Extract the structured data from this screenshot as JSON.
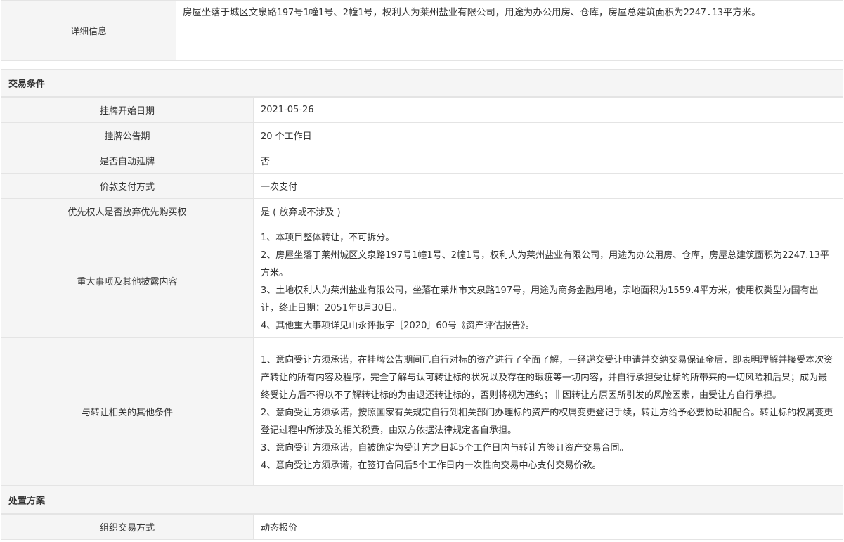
{
  "detail": {
    "label": "详细信息",
    "text": "房屋坐落于城区文泉路197号1幢1号、2幢1号，权利人为莱州盐业有限公司，用途为办公用房、仓库，房屋总建筑面积为2247.13平方米。"
  },
  "trade_conditions": {
    "title": "交易条件",
    "rows": [
      {
        "label": "挂牌开始日期",
        "value": "2021-05-26"
      },
      {
        "label": "挂牌公告期",
        "value": "20 个工作日"
      },
      {
        "label": "是否自动延牌",
        "value": "否"
      },
      {
        "label": "价款支付方式",
        "value": "一次支付"
      },
      {
        "label": "优先权人是否放弃优先购买权",
        "value": "是 ( 放弃或不涉及 )"
      }
    ],
    "major_matters": {
      "label": "重大事项及其他披露内容",
      "items": [
        "1、本项目整体转让，不可拆分。",
        "2、房屋坐落于莱州城区文泉路197号1幢1号、2幢1号，权利人为莱州盐业有限公司，用途为办公用房、仓库，房屋总建筑面积为2247.13平方米。",
        "3、土地权利人为莱州盐业有限公司，坐落在莱州市文泉路197号，用途为商务金融用地，宗地面积为1559.4平方米，使用权类型为国有出让，终止日期：2051年8月30日。",
        "4、其他重大事项详见山永评报字［2020］60号《资产评估报告》。"
      ]
    },
    "other_conditions": {
      "label": "与转让相关的其他条件",
      "items": [
        "1、意向受让方须承诺，在挂牌公告期间已自行对标的资产进行了全面了解，一经递交受让申请并交纳交易保证金后，即表明理解并接受本次资产转让的所有内容及程序，完全了解与认可转让标的状况以及存在的瑕疵等一切内容，并自行承担受让标的所带来的一切风险和后果；成为最终受让方后不得以不了解转让标的为由退还转让标的，否则将视为违约；非因转让方原因所引发的风险因素，由受让方自行承担。",
        "2、意向受让方须承诺，按照国家有关规定自行到相关部门办理标的资产的权属变更登记手续，转让方给予必要协助和配合。转让标的权属变更登记过程中所涉及的相关税费，由双方依据法律规定各自承担。",
        "3、意向受让方须承诺，自被确定为受让方之日起5个工作日内与转让方签订资产交易合同。",
        "4、意向受让方须承诺，在签订合同后5个工作日内一次性向交易中心支付交易价款。"
      ]
    }
  },
  "disposal_plan": {
    "title": "处置方案",
    "rows": [
      {
        "label": "组织交易方式",
        "value": "动态报价"
      }
    ]
  }
}
